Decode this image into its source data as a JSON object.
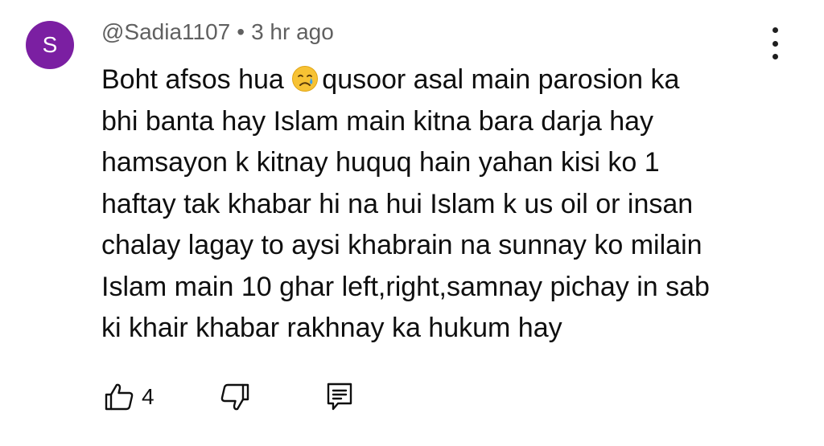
{
  "comment": {
    "avatar_letter": "S",
    "avatar_color": "#7b1fa2",
    "author": "@Sadia1107",
    "separator": "•",
    "time": "3 hr ago",
    "lines": {
      "l1a": "Boht afsos hua ",
      "l1b": "qusoor asal main parosion ka",
      "l2": "bhi banta hay Islam main kitna bara darja hay",
      "l3": "hamsayon k kitnay huquq hain yahan kisi ko 1",
      "l4": "haftay tak khabar hi na hui Islam k us oil or insan",
      "l5": "chalay lagay to aysi khabrain na sunnay ko milain",
      "l6": "Islam main 10 ghar left,right,samnay pichay in sab",
      "l7": "ki khair khabar rakhnay ka hukum hay"
    },
    "emoji": "crying-face-icon",
    "like_count": "4"
  }
}
